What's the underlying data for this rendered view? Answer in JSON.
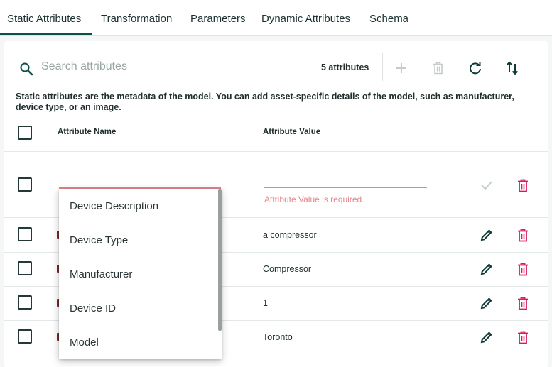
{
  "tabs": [
    {
      "label": "Static Attributes",
      "active": true
    },
    {
      "label": "Transformation",
      "active": false
    },
    {
      "label": "Parameters",
      "active": false
    },
    {
      "label": "Dynamic Attributes",
      "active": false
    },
    {
      "label": "Schema",
      "active": false
    }
  ],
  "toolbar": {
    "search_placeholder": "Search attributes",
    "count_label": "5 attributes",
    "icons": [
      "add-icon",
      "delete-icon",
      "refresh-icon",
      "sort-icon"
    ]
  },
  "description": "Static attributes are the metadata of the model. You can add asset-specific details of the model, such as manufacturer, device type, or an image.",
  "table": {
    "headers": [
      "Attribute Name",
      "Attribute Value"
    ],
    "new_row": {
      "name_value": "",
      "value_value": "",
      "error": "Attribute Value is required."
    },
    "rows": [
      {
        "value": "a compressor"
      },
      {
        "value": "Compressor"
      },
      {
        "value": "1"
      },
      {
        "value": "Toronto"
      }
    ]
  },
  "dropdown": {
    "options": [
      "Device Description",
      "Device Type",
      "Manufacturer",
      "Device ID",
      "Model"
    ]
  },
  "colors": {
    "accent": "#0d4d4a",
    "danger": "#d81b60",
    "error": "#e7858f",
    "disabled": "#c4cccc"
  }
}
